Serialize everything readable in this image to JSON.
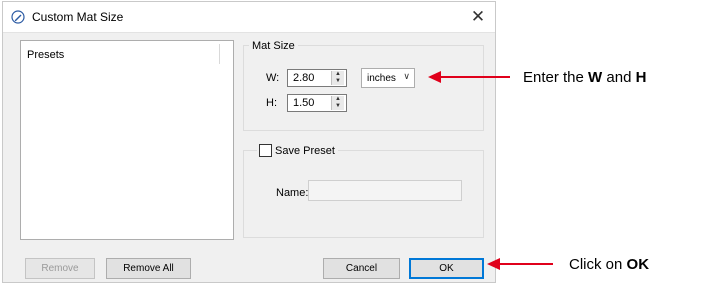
{
  "window": {
    "title": "Custom Mat Size",
    "close_glyph": "✕"
  },
  "presets": {
    "header": "Presets"
  },
  "mat_size": {
    "legend": "Mat Size",
    "w_label": "W:",
    "w_value": "2.80",
    "h_label": "H:",
    "h_value": "1.50",
    "units": "inches",
    "units_chevron": "∨"
  },
  "save_preset": {
    "label": "Save Preset",
    "checked": false,
    "name_label": "Name:",
    "name_value": ""
  },
  "buttons": {
    "remove": "Remove",
    "remove_all": "Remove All",
    "cancel": "Cancel",
    "ok": "OK"
  },
  "annotations": {
    "size_prefix": "Enter the ",
    "size_bold_w": "W",
    "size_and": " and ",
    "size_bold_h": "H",
    "ok_prefix": "Click on ",
    "ok_bold": "OK",
    "arrow_color": "#e0001b"
  },
  "icons": {
    "app": "pen-circle-icon",
    "close": "close-icon",
    "spin_up": "spin-up-icon",
    "spin_down": "spin-down-icon",
    "dropdown": "chevron-down-icon"
  }
}
